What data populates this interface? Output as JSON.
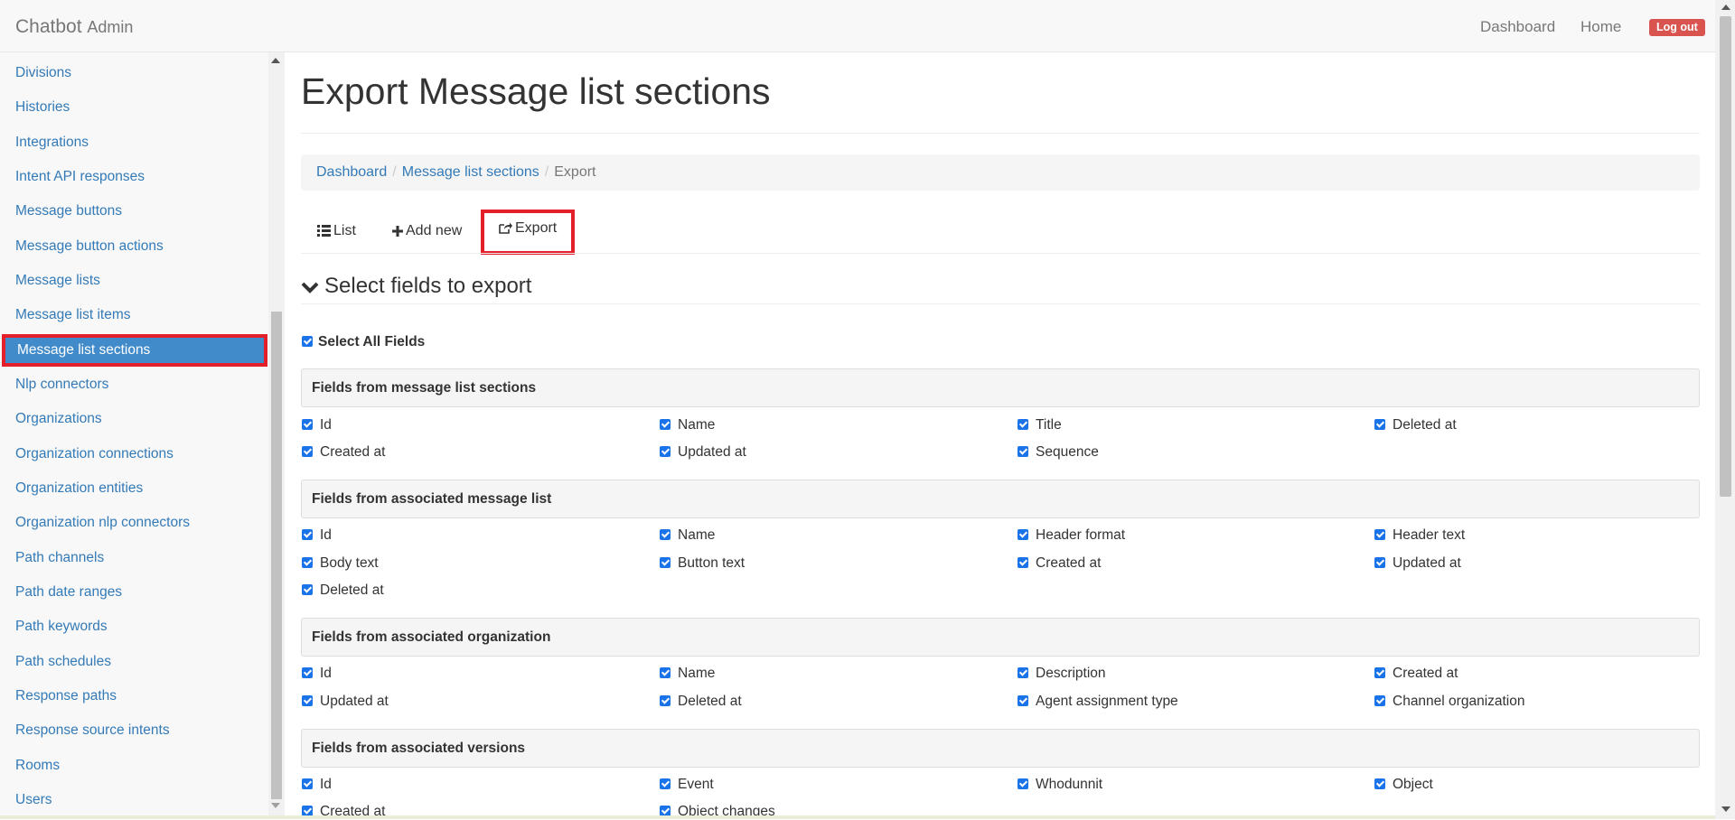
{
  "navbar": {
    "brand": "Chatbot",
    "brand_sub": "Admin",
    "dashboard": "Dashboard",
    "home": "Home",
    "logout": "Log out"
  },
  "sidebar": {
    "items": [
      {
        "label": "Divisions"
      },
      {
        "label": "Histories"
      },
      {
        "label": "Integrations"
      },
      {
        "label": "Intent API responses"
      },
      {
        "label": "Message buttons"
      },
      {
        "label": "Message button actions"
      },
      {
        "label": "Message lists"
      },
      {
        "label": "Message list items"
      },
      {
        "label": "Message list sections",
        "active": true
      },
      {
        "label": "Nlp connectors"
      },
      {
        "label": "Organizations"
      },
      {
        "label": "Organization connections"
      },
      {
        "label": "Organization entities"
      },
      {
        "label": "Organization nlp connectors"
      },
      {
        "label": "Path channels"
      },
      {
        "label": "Path date ranges"
      },
      {
        "label": "Path keywords"
      },
      {
        "label": "Path schedules"
      },
      {
        "label": "Response paths"
      },
      {
        "label": "Response source intents"
      },
      {
        "label": "Rooms"
      },
      {
        "label": "Users"
      }
    ]
  },
  "page": {
    "title": "Export Message list sections",
    "breadcrumb": {
      "dashboard": "Dashboard",
      "section": "Message list sections",
      "current": "Export"
    },
    "tabs": {
      "list": "List",
      "add_new": "Add new",
      "export": "Export"
    },
    "section_title": "Select fields to export",
    "select_all": "Select All Fields"
  },
  "groups": [
    {
      "title": "Fields from message list sections",
      "fields": [
        "Id",
        "Name",
        "Title",
        "Deleted at",
        "Created at",
        "Updated at",
        "Sequence"
      ]
    },
    {
      "title": "Fields from associated message list",
      "fields": [
        "Id",
        "Name",
        "Header format",
        "Header text",
        "Body text",
        "Button text",
        "Created at",
        "Updated at",
        "Deleted at"
      ]
    },
    {
      "title": "Fields from associated organization",
      "fields": [
        "Id",
        "Name",
        "Description",
        "Created at",
        "Updated at",
        "Deleted at",
        "Agent assignment type",
        "Channel organization"
      ]
    },
    {
      "title": "Fields from associated versions",
      "fields": [
        "Id",
        "Event",
        "Whodunnit",
        "Object",
        "Created at",
        "Object changes"
      ]
    }
  ],
  "colors": {
    "accent": "#337ab7",
    "active": "#428bca",
    "highlight": "#e3202a",
    "checkbox": "#1a73e8",
    "danger": "#d9534f"
  }
}
